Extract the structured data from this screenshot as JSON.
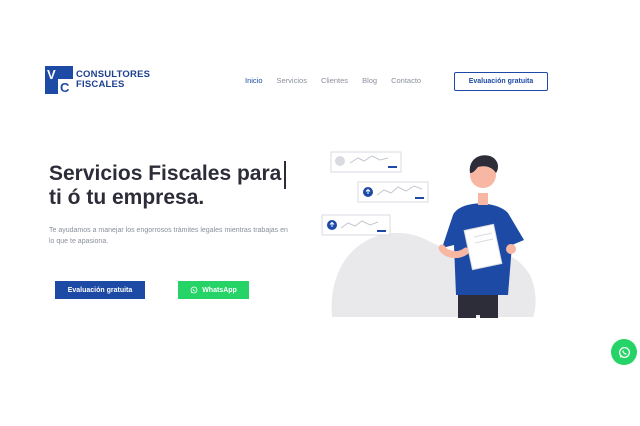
{
  "brand": {
    "initials": "VC",
    "line1": "CONSULTORES",
    "line2": "FISCALES",
    "color": "#1d4aa5"
  },
  "nav": {
    "items": [
      {
        "label": "Inicio",
        "active": true
      },
      {
        "label": "Servicios",
        "active": false
      },
      {
        "label": "Clientes",
        "active": false
      },
      {
        "label": "Blog",
        "active": false
      },
      {
        "label": "Contacto",
        "active": false
      }
    ],
    "cta_label": "Evaluación gratuita"
  },
  "hero": {
    "title_line1": "Servicios Fiscales para",
    "title_line2": "ti ó tu empresa.",
    "subtitle": "Te ayudamos a manejar los engorrosos trámites legales mientras trabajas en lo que te apasiona.",
    "primary_button": "Evaluación gratuita",
    "whatsapp_button": "WhatsApp"
  },
  "colors": {
    "accent": "#1d4aa5",
    "whatsapp": "#25d366",
    "text": "#2d2d3a",
    "muted": "#8a8f9c"
  },
  "icons": {
    "whatsapp": "whatsapp-icon",
    "floating": "whatsapp-floating-icon"
  }
}
